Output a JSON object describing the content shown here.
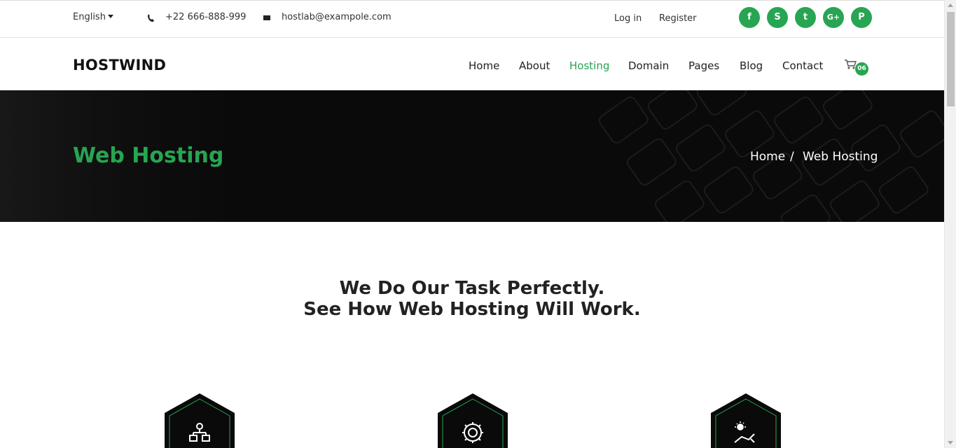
{
  "topbar": {
    "language": "English",
    "phone": "+22 666-888-999",
    "email": "hostlab@exampole.com",
    "login": "Log in",
    "register": "Register",
    "social": [
      {
        "icon": "facebook-icon",
        "glyph": "f"
      },
      {
        "icon": "skype-icon",
        "glyph": "S"
      },
      {
        "icon": "twitter-icon",
        "glyph": "t"
      },
      {
        "icon": "google-plus-icon",
        "glyph": "G+"
      },
      {
        "icon": "pinterest-icon",
        "glyph": "P"
      }
    ]
  },
  "nav": {
    "logo": "HOSTWIND",
    "links": [
      "Home",
      "About",
      "Hosting",
      "Domain",
      "Pages",
      "Blog",
      "Contact"
    ],
    "active": "Hosting",
    "cart_count": "06"
  },
  "hero": {
    "title": "Web Hosting",
    "breadcrumb_home": "Home",
    "breadcrumb_sep": "/",
    "breadcrumb_current": "Web Hosting"
  },
  "main": {
    "headline_line1": "We Do Our Task Perfectly.",
    "headline_line2": "See How Web Hosting Will Work.",
    "features": [
      {
        "icon": "network-icon"
      },
      {
        "icon": "gear-icon"
      },
      {
        "icon": "sun-graph-icon"
      }
    ]
  },
  "colors": {
    "accent": "#27a552",
    "hero_bg": "#0a0a0a"
  }
}
